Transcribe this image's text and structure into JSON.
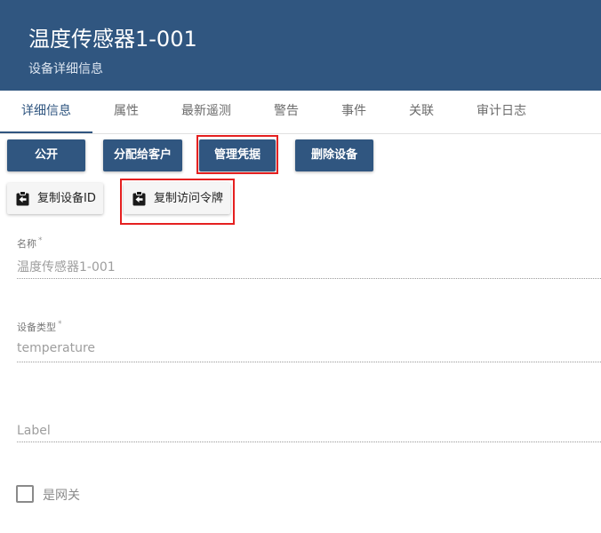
{
  "header": {
    "title": "温度传感器1-001",
    "subtitle": "设备详细信息"
  },
  "tabs": [
    {
      "label": "详细信息",
      "active": true
    },
    {
      "label": "属性"
    },
    {
      "label": "最新遥测"
    },
    {
      "label": "警告"
    },
    {
      "label": "事件"
    },
    {
      "label": "关联"
    },
    {
      "label": "审计日志"
    }
  ],
  "actions": {
    "public": "公开",
    "assign_customer": "分配给客户",
    "manage_credentials": "管理凭据",
    "delete_device": "删除设备"
  },
  "copy_actions": {
    "copy_device_id": "复制设备ID",
    "copy_access_token": "复制访问令牌",
    "icon": "clipboard-arrow-left-icon"
  },
  "form": {
    "name_label": "名称",
    "name_value": "温度传感器1-001",
    "type_label": "设备类型",
    "type_value": "temperature",
    "label_placeholder": "Label",
    "required_mark": "*",
    "gateway_label": "是网关"
  },
  "colors": {
    "primary": "#305680",
    "highlight": "#e52020"
  }
}
